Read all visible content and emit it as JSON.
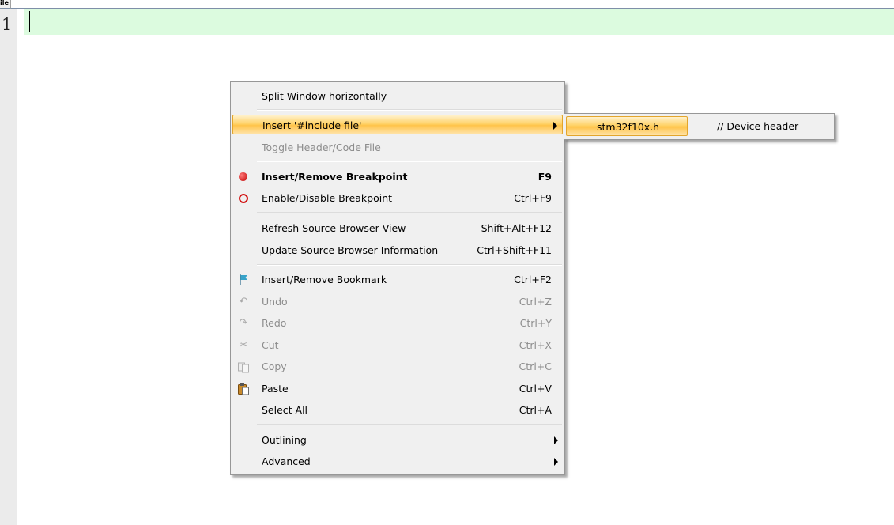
{
  "tab": {
    "label": "ile"
  },
  "editor": {
    "line_number": "1"
  },
  "context_menu": {
    "items": [
      {
        "label": "Split Window horizontally",
        "shortcut": ""
      },
      {
        "label": "Insert '#include file'",
        "shortcut": ""
      },
      {
        "label": "Toggle Header/Code File",
        "shortcut": ""
      },
      {
        "label": "Insert/Remove Breakpoint",
        "shortcut": "F9"
      },
      {
        "label": "Enable/Disable Breakpoint",
        "shortcut": "Ctrl+F9"
      },
      {
        "label": "Refresh Source Browser View",
        "shortcut": "Shift+Alt+F12"
      },
      {
        "label": "Update Source Browser Information",
        "shortcut": "Ctrl+Shift+F11"
      },
      {
        "label": "Insert/Remove Bookmark",
        "shortcut": "Ctrl+F2"
      },
      {
        "label": "Undo",
        "shortcut": "Ctrl+Z"
      },
      {
        "label": "Redo",
        "shortcut": "Ctrl+Y"
      },
      {
        "label": "Cut",
        "shortcut": "Ctrl+X"
      },
      {
        "label": "Copy",
        "shortcut": "Ctrl+C"
      },
      {
        "label": "Paste",
        "shortcut": "Ctrl+V"
      },
      {
        "label": "Select All",
        "shortcut": "Ctrl+A"
      },
      {
        "label": "Outlining",
        "shortcut": ""
      },
      {
        "label": "Advanced",
        "shortcut": ""
      }
    ]
  },
  "submenu": {
    "file": "stm32f10x.h",
    "comment": "// Device header"
  },
  "colors": {
    "highlight": "#ffc44a",
    "current_line": "#dcfbdf",
    "breakpoint": "#d21414"
  }
}
